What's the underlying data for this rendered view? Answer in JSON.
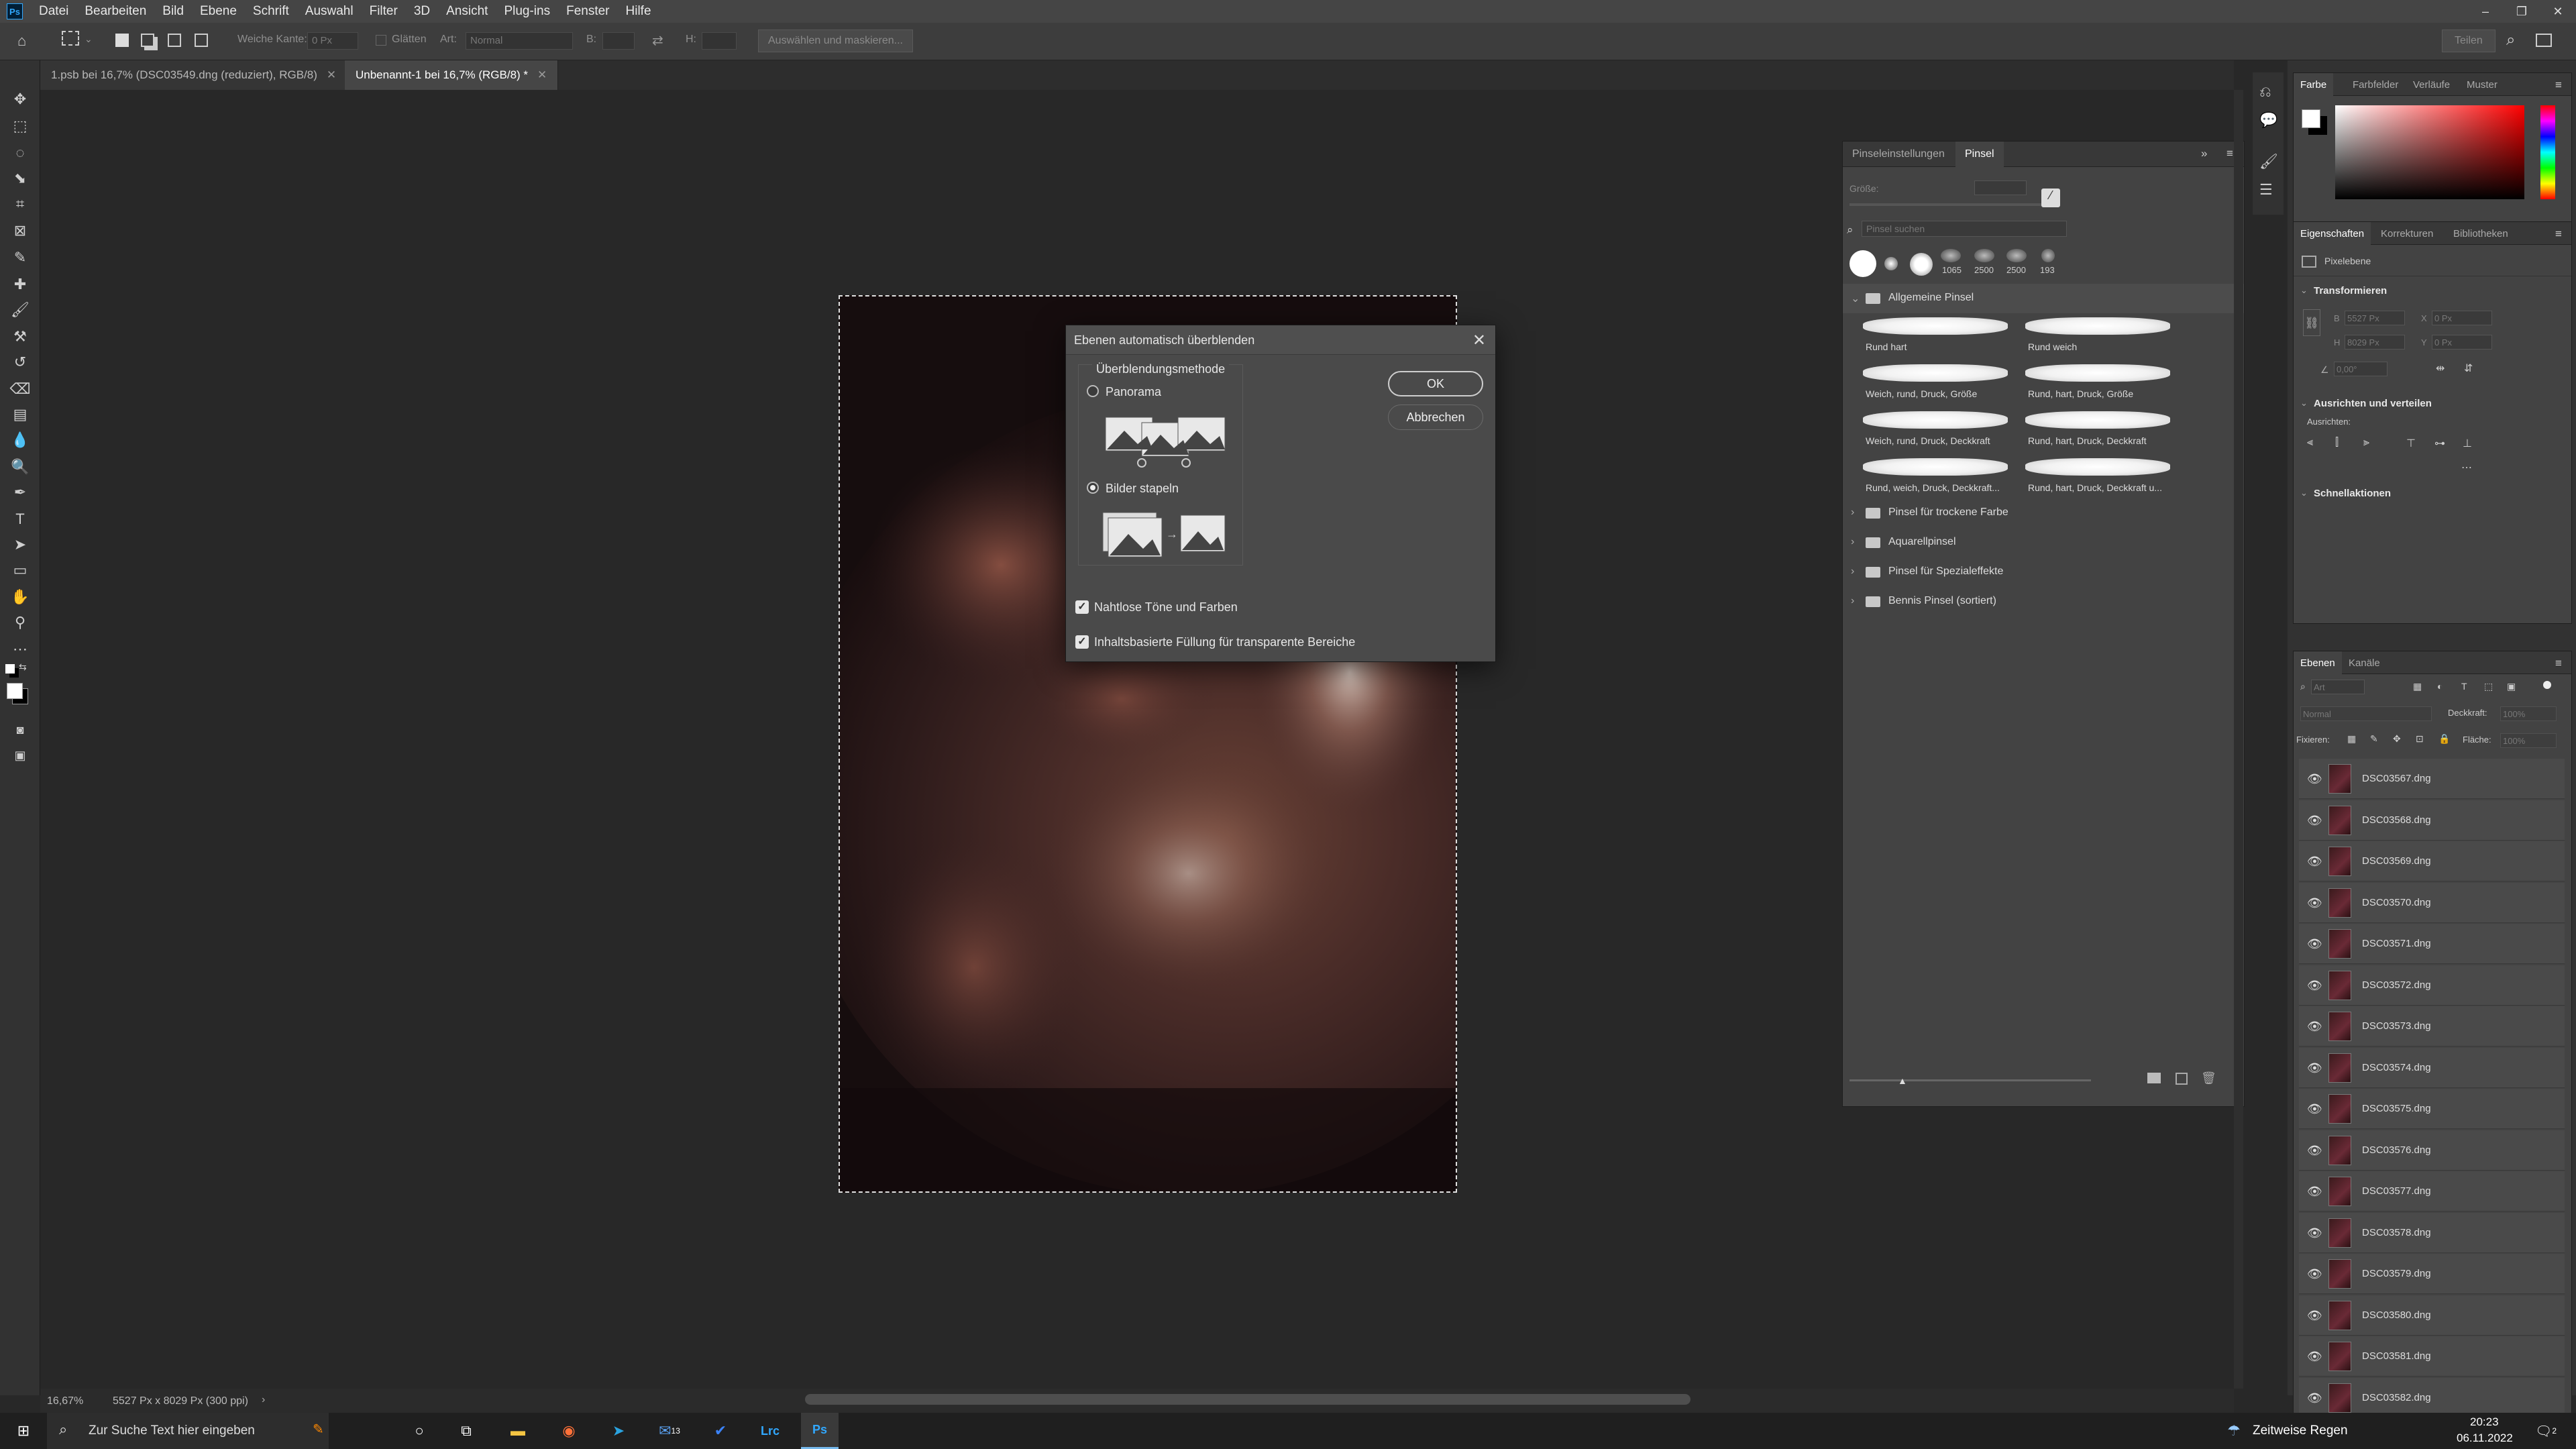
{
  "menubar": {
    "items": [
      "Datei",
      "Bearbeiten",
      "Bild",
      "Ebene",
      "Schrift",
      "Auswahl",
      "Filter",
      "3D",
      "Ansicht",
      "Plug-ins",
      "Fenster",
      "Hilfe"
    ]
  },
  "options": {
    "feather_label": "Weiche Kante:",
    "feather_value": "0 Px",
    "smooth_label": "Glätten",
    "style_label": "Art:",
    "style_value": "Normal",
    "width_label": "B:",
    "height_label": "H:",
    "select_mask": "Auswählen und maskieren...",
    "share": "Teilen"
  },
  "tabs": [
    {
      "label": "1.psb bei 16,7% (DSC03549.dng (reduziert), RGB/8)"
    },
    {
      "label": "Unbenannt-1 bei 16,7% (RGB/8) *"
    }
  ],
  "status": {
    "zoom": "16,67%",
    "dims": "5527 Px x 8029 Px (300 ppi)"
  },
  "dialog": {
    "title": "Ebenen automatisch überblenden",
    "group_label": "Überblendungsmethode",
    "opt_panorama": "Panorama",
    "opt_stack": "Bilder stapeln",
    "chk_seamless": "Nahtlose Töne und Farben",
    "chk_content": "Inhaltsbasierte Füllung für transparente Bereiche",
    "ok": "OK",
    "cancel": "Abbrechen"
  },
  "brush_panel": {
    "tab1": "Pinseleinstellungen",
    "tab2": "Pinsel",
    "size_label": "Größe:",
    "search_placeholder": "Pinsel suchen",
    "preset_sizes": [
      "1065",
      "2500",
      "2500",
      "193"
    ],
    "group_open": "Allgemeine Pinsel",
    "brushes": [
      "Rund hart",
      "Rund weich",
      "Weich, rund, Druck, Größe",
      "Rund, hart, Druck, Größe",
      "Weich, rund, Druck, Deckkraft",
      "Rund, hart, Druck, Deckkraft",
      "Rund, weich, Druck, Deckkraft...",
      "Rund, hart, Druck, Deckkraft u..."
    ],
    "folders": [
      "Pinsel für trockene Farbe",
      "Aquarellpinsel",
      "Pinsel für Spezialeffekte",
      "Bennis Pinsel (sortiert)"
    ]
  },
  "color_panel": {
    "tabs": [
      "Farbe",
      "Farbfelder",
      "Verläufe",
      "Muster"
    ]
  },
  "props_panel": {
    "tabs": [
      "Eigenschaften",
      "Korrekturen",
      "Bibliotheken"
    ],
    "layer_type": "Pixelebene",
    "transform": "Transformieren",
    "w_label": "B",
    "w_value": "5527 Px",
    "x_label": "X",
    "x_value": "0 Px",
    "h_label": "H",
    "h_value": "8029 Px",
    "y_label": "Y",
    "y_value": "0 Px",
    "angle_value": "0,00°",
    "align": "Ausrichten und verteilen",
    "align_sub": "Ausrichten:",
    "quick": "Schnellaktionen"
  },
  "layers_panel": {
    "tabs": [
      "Ebenen",
      "Kanäle"
    ],
    "filter_placeholder": "Art",
    "blend_mode": "Normal",
    "opacity_label": "Deckkraft:",
    "opacity_value": "100%",
    "lock_label": "Fixieren:",
    "fill_label": "Fläche:",
    "fill_value": "100%",
    "layers": [
      "DSC03567.dng",
      "DSC03568.dng",
      "DSC03569.dng",
      "DSC03570.dng",
      "DSC03571.dng",
      "DSC03572.dng",
      "DSC03573.dng",
      "DSC03574.dng",
      "DSC03575.dng",
      "DSC03576.dng",
      "DSC03577.dng",
      "DSC03578.dng",
      "DSC03579.dng",
      "DSC03580.dng",
      "DSC03581.dng",
      "DSC03582.dng"
    ]
  },
  "taskbar": {
    "search": "Zur Suche Text hier eingeben",
    "weather": "Zeitweise Regen",
    "time": "20:23",
    "date": "06.11.2022",
    "mail_badge": "13",
    "notif_badge": "2"
  }
}
